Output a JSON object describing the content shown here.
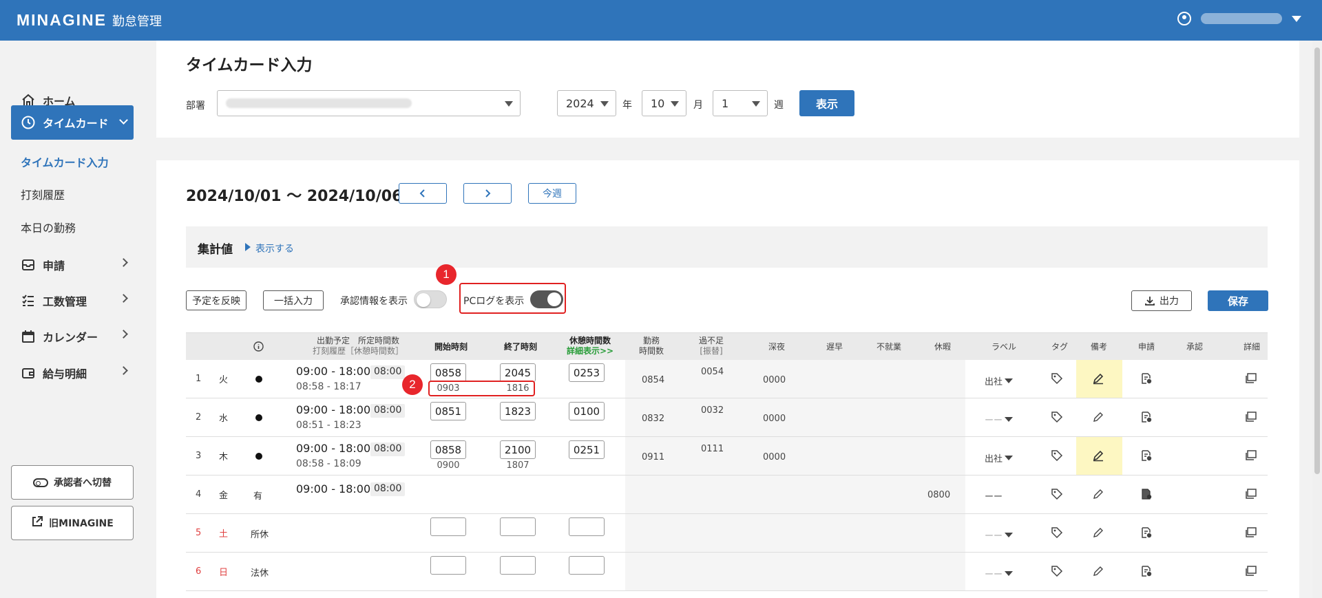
{
  "header": {
    "logo": "MINAGINE",
    "subtitle": "勤怠管理"
  },
  "sidebar": {
    "items": [
      {
        "label": "ホーム",
        "icon": "home-icon"
      },
      {
        "label": "タイムカード",
        "icon": "clock-icon"
      },
      {
        "label": "申請",
        "icon": "inbox-icon"
      },
      {
        "label": "工数管理",
        "icon": "checklist-icon"
      },
      {
        "label": "カレンダー",
        "icon": "calendar-icon"
      },
      {
        "label": "給与明細",
        "icon": "wallet-icon"
      }
    ],
    "sub_items": [
      "タイムカード入力",
      "打刻履歴",
      "本日の勤務"
    ],
    "switch_button": "承認者へ切替",
    "old_button": "旧MINAGINE"
  },
  "filter": {
    "title": "タイムカード入力",
    "dept_label": "部署",
    "year": "2024",
    "year_unit": "年",
    "month": "10",
    "month_unit": "月",
    "week": "1",
    "week_unit": "週",
    "show_button": "表示"
  },
  "main": {
    "date_range": "2024/10/01 〜 2024/10/06",
    "this_week": "今週",
    "summary_title": "集計値",
    "summary_link": "表示する",
    "reflect_button": "予定を反映",
    "bulk_button": "一括入力",
    "approval_toggle_label": "承認情報を表示",
    "pclog_toggle_label": "PCログを表示",
    "export_button": "出力",
    "save_button": "保存",
    "marker1": "1",
    "marker2": "2"
  },
  "table": {
    "headers": {
      "sched_line1": "出勤予定　所定時間数",
      "sched_line2": "打刻履歴［休憩時間数］",
      "start": "開始時刻",
      "end": "終了時刻",
      "break": "休憩時間数",
      "break_detail": "詳細表示>>",
      "work_1": "勤務",
      "work_2": "時間数",
      "over_1": "過不足",
      "over_2": "[振替]",
      "night": "深夜",
      "late": "遅早",
      "absent": "不就業",
      "leave": "休暇",
      "label": "ラベル",
      "tag": "タグ",
      "note": "備考",
      "apply": "申請",
      "approve": "承認",
      "detail": "詳細"
    },
    "rows": [
      {
        "no": "1",
        "dow": "火",
        "sched": "09:00 - 18:00",
        "hours": "08:00",
        "hist": "08:58 - 18:17",
        "start": "0858",
        "end": "2045",
        "brk": "0253",
        "pc_start": "0903",
        "pc_end": "1816",
        "work": "0854",
        "over": "0054",
        "night": "0000",
        "label": "出社"
      },
      {
        "no": "2",
        "dow": "水",
        "sched": "09:00 - 18:00",
        "hours": "08:00",
        "hist": "08:51 - 18:23",
        "start": "0851",
        "end": "1823",
        "brk": "0100",
        "work": "0832",
        "over": "0032",
        "night": "0000",
        "label": "ーー"
      },
      {
        "no": "3",
        "dow": "木",
        "sched": "09:00 - 18:00",
        "hours": "08:00",
        "hist": "08:58 - 18:09",
        "start": "0858",
        "end": "2100",
        "brk": "0251",
        "pc_start": "0900",
        "pc_end": "1807",
        "work": "0911",
        "over": "0111",
        "night": "0000",
        "label": "出社"
      },
      {
        "no": "4",
        "dow": "金",
        "type": "有",
        "sched": "09:00 - 18:00",
        "hours": "08:00",
        "leave": "0800",
        "label": "ーー"
      },
      {
        "no": "5",
        "dow": "土",
        "type": "所休",
        "label": "ーー"
      },
      {
        "no": "6",
        "dow": "日",
        "type": "法休",
        "label": "ーー"
      }
    ]
  }
}
